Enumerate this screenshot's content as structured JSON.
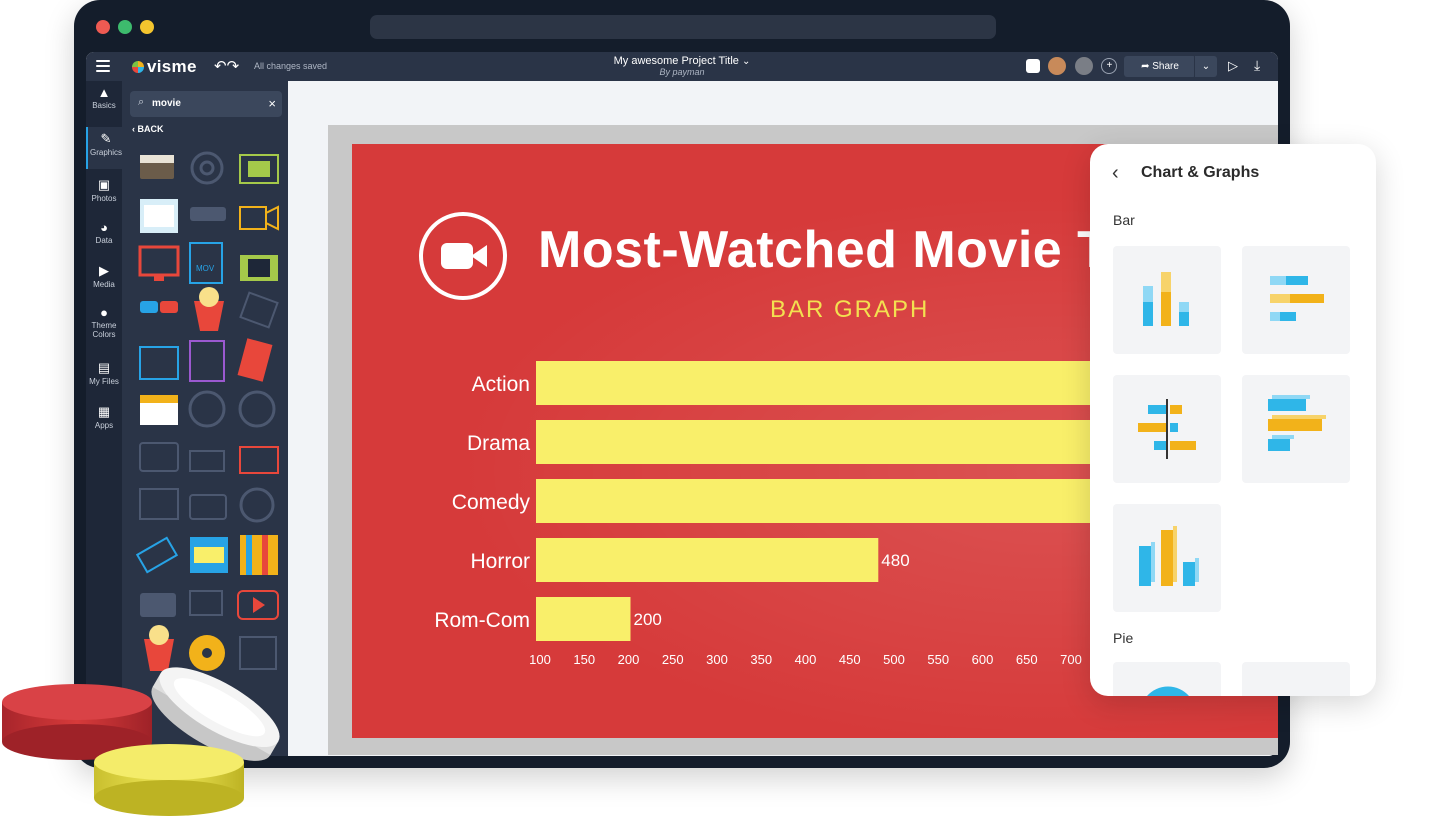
{
  "toolbar": {
    "logo_text": "visme",
    "saved_status": "All changes saved",
    "project_title": "My awesome Project Title",
    "project_author": "By payman",
    "share_label": "Share"
  },
  "rail": {
    "items": [
      {
        "label": "Basics"
      },
      {
        "label": "Graphics"
      },
      {
        "label": "Photos"
      },
      {
        "label": "Data"
      },
      {
        "label": "Media"
      },
      {
        "label": "Theme Colors"
      },
      {
        "label": "My Files"
      },
      {
        "label": "Apps"
      }
    ]
  },
  "panel": {
    "search_value": "movie",
    "back_label": "BACK"
  },
  "slide": {
    "title": "Most-Watched Movie T",
    "subtitle": "BAR GRAPH"
  },
  "chart_data": {
    "type": "bar",
    "orientation": "horizontal",
    "categories": [
      "Action",
      "Drama",
      "Comedy",
      "Horror",
      "Rom-Com"
    ],
    "values": [
      760,
      760,
      760,
      480,
      200
    ],
    "data_labels": [
      "",
      "",
      "",
      "480",
      "200"
    ],
    "xlim": [
      100,
      700
    ],
    "xticks": [
      "100",
      "150",
      "200",
      "250",
      "300",
      "350",
      "400",
      "450",
      "500",
      "550",
      "600",
      "650",
      "700"
    ],
    "bar_color": "#f9ef6a",
    "grid": false
  },
  "charts_panel": {
    "title": "Chart & Graphs",
    "section_bar": "Bar",
    "section_pie": "Pie"
  },
  "colors": {
    "slide_bg": "#d63a3a",
    "accent_blue": "#27a3e6",
    "accent_yellow": "#f2b21a"
  }
}
